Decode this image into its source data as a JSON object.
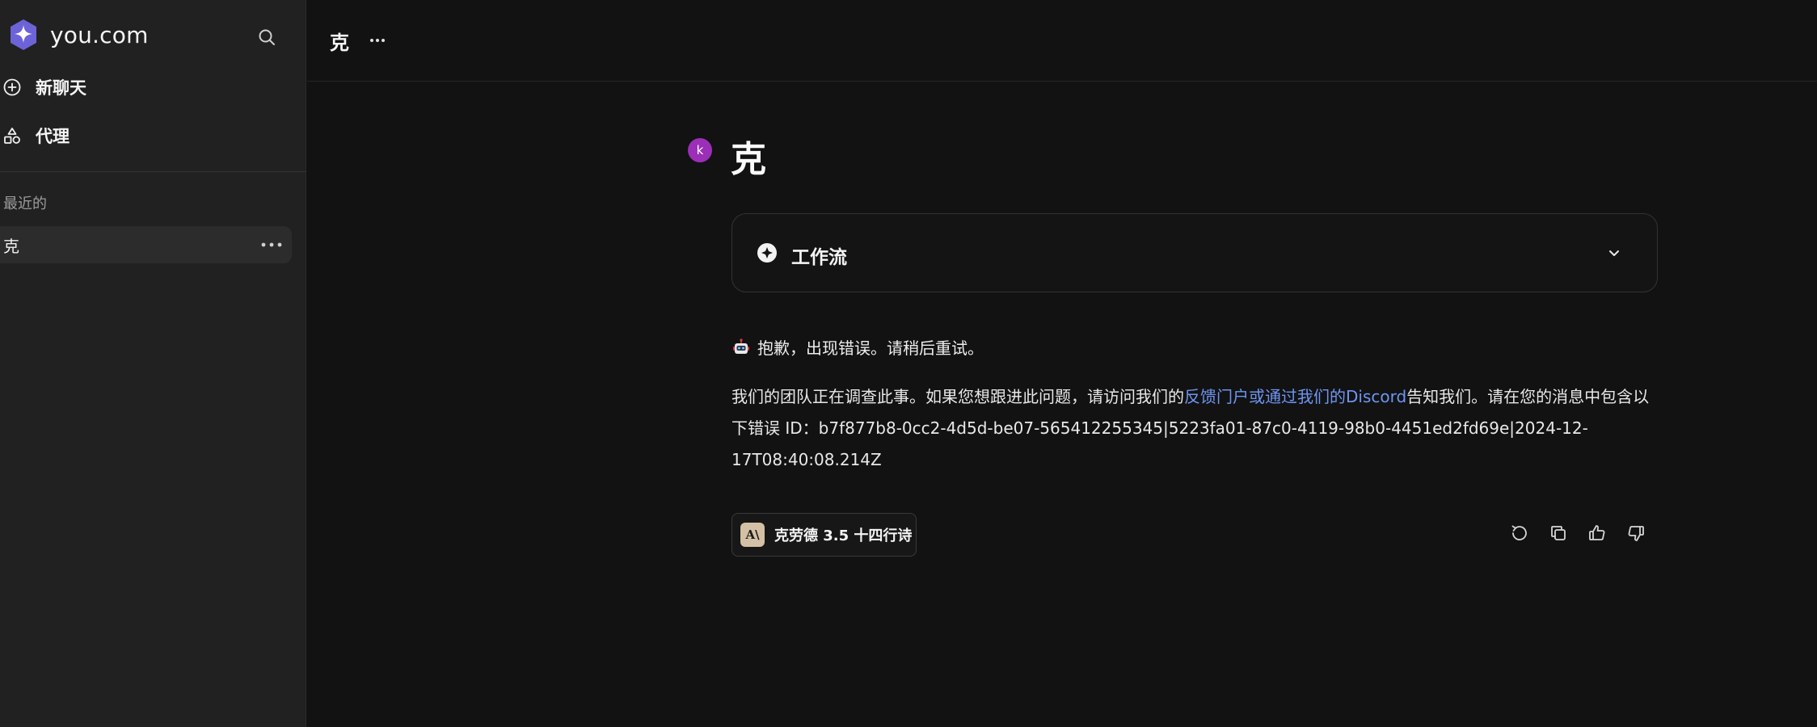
{
  "sidebar": {
    "brand": "you.com",
    "nav": {
      "new_chat": "新聊天",
      "agents": "代理"
    },
    "recent_label": "最近的",
    "recent_items": [
      {
        "label": "克"
      }
    ]
  },
  "header": {
    "title": "克"
  },
  "thread": {
    "avatar_letter": "k",
    "query": "克",
    "workflow_label": "工作流",
    "error_title": "抱歉，出现错误。请稍后重试。",
    "error_body_pre": "我们的团队正在调查此事。如果您想跟进此问题，请访问我们的",
    "error_body_link": "反馈门户或通过我们的Discord",
    "error_body_post": "告知我们。请在您的消息中包含以下错误 ID：b7f877b8-0cc2-4d5d-be07-565412255345|5223fa01-87c0-4119-98b0-4451ed2fd69e|2024-12-17T08:40:08.214Z",
    "model_badge": "A\\",
    "model_label": "克劳德 3.5 十四行诗"
  },
  "colors": {
    "background": "#121212",
    "sidebar": "#212121",
    "link": "#6f95f2",
    "avatar": "#9b2fb8",
    "brand_logo": "#6c63d9"
  },
  "icons": {
    "brand": "you-logo-icon",
    "search": "search-icon",
    "new_chat": "plus-circle-icon",
    "agents": "shapes-icon",
    "more": "more-horizontal-icon",
    "workflow": "workflow-icon",
    "chevron": "chevron-down-icon",
    "error": "robot-emoji-icon",
    "actions": [
      "regenerate-icon",
      "copy-icon",
      "thumbs-up-icon",
      "thumbs-down-icon"
    ]
  }
}
